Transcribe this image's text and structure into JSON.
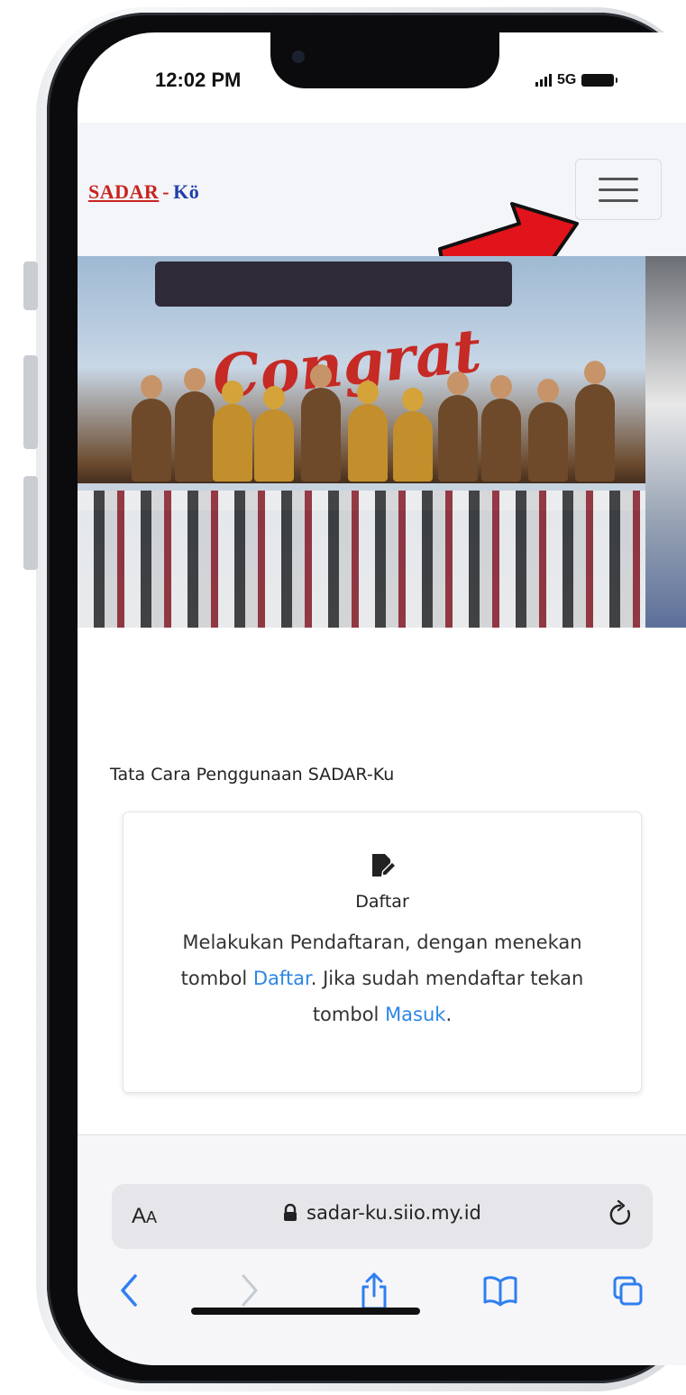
{
  "status_bar": {
    "time": "12:02 PM",
    "network": "5G"
  },
  "navbar": {
    "logo_part1": "SADAR",
    "logo_dash": "-",
    "logo_part2": "Kö"
  },
  "banner": {
    "headline": "Congrat !"
  },
  "content": {
    "section_title": "Tata Cara Penggunaan SADAR-Ku",
    "card": {
      "title": "Daftar",
      "body_1": "Melakukan Pendaftaran, dengan menekan tombol ",
      "link_daftar": "Daftar",
      "body_2": ". Jika sudah mendaftar tekan tombol ",
      "link_masuk": "Masuk",
      "body_3": "."
    }
  },
  "browser": {
    "text_size_label": "A",
    "text_size_label_small": "A",
    "url": "sadar-ku.siio.my.id"
  },
  "colors": {
    "accent_link": "#2d86e6",
    "arrow": "#e0141a",
    "logo_red": "#c8231f",
    "logo_blue": "#1f3fa8"
  },
  "icons": [
    "edit-icon",
    "lock-icon",
    "reload-icon",
    "back-icon",
    "forward-icon",
    "share-icon",
    "bookmarks-icon",
    "tabs-icon",
    "menu-icon"
  ]
}
